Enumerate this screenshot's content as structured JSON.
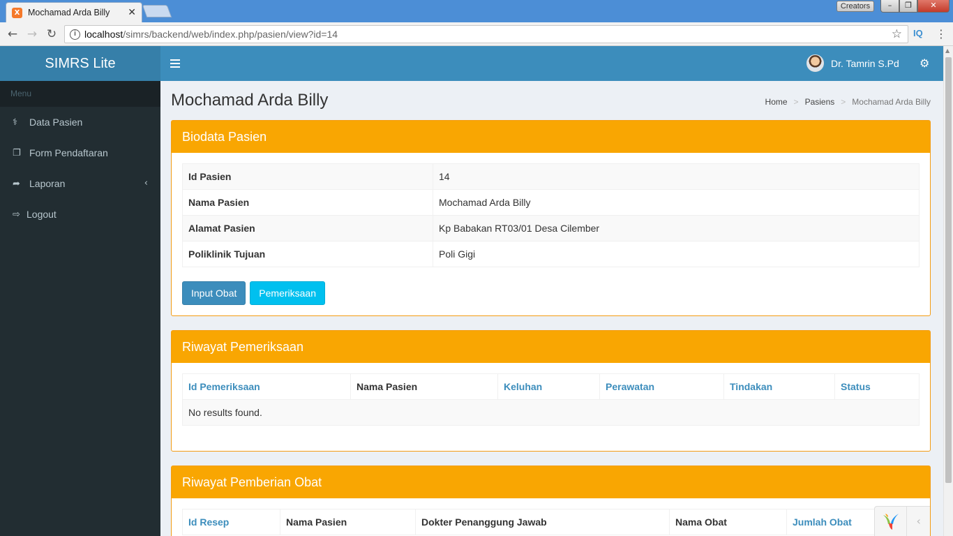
{
  "browser": {
    "tab_title": "Mochamad Arda Billy",
    "favicon_letter": "X",
    "creators_label": "Creators",
    "url_host": "localhost",
    "url_path": "/simrs/backend/web/index.php/pasien/view?id=14",
    "ext_label": "IQ"
  },
  "header": {
    "logo": "SIMRS Lite",
    "user_name": "Dr. Tamrin S.Pd"
  },
  "sidebar": {
    "header": "Menu",
    "items": [
      {
        "label": "Data Pasien",
        "icon": "stethoscope-icon"
      },
      {
        "label": "Form Pendaftaran",
        "icon": "copy-icon"
      },
      {
        "label": "Laporan",
        "icon": "share-icon"
      },
      {
        "label": "Logout",
        "icon": "sign-out-icon"
      }
    ]
  },
  "page": {
    "title": "Mochamad Arda Billy",
    "breadcrumb": [
      "Home",
      "Pasiens",
      "Mochamad Arda Billy"
    ]
  },
  "biodata": {
    "title": "Biodata Pasien",
    "rows": [
      {
        "label": "Id Pasien",
        "value": "14"
      },
      {
        "label": "Nama Pasien",
        "value": "Mochamad Arda Billy"
      },
      {
        "label": "Alamat Pasien",
        "value": "Kp Babakan RT03/01 Desa Cilember"
      },
      {
        "label": "Poliklinik Tujuan",
        "value": "Poli Gigi"
      }
    ],
    "btn_input_obat": "Input Obat",
    "btn_pemeriksaan": "Pemeriksaan"
  },
  "pemeriksaan": {
    "title": "Riwayat Pemeriksaan",
    "columns": [
      "Id Pemeriksaan",
      "Nama Pasien",
      "Keluhan",
      "Perawatan",
      "Tindakan",
      "Status"
    ],
    "empty": "No results found."
  },
  "obat": {
    "title": "Riwayat Pemberian Obat",
    "columns": [
      "Id Resep",
      "Nama Pasien",
      "Dokter Penanggung Jawab",
      "Nama Obat",
      "Jumlah Obat"
    ]
  },
  "colors": {
    "header_blue": "#3c8dbc",
    "sidebar_dark": "#222d32",
    "box_orange": "#f9a602",
    "btn_info": "#00c0ef"
  }
}
